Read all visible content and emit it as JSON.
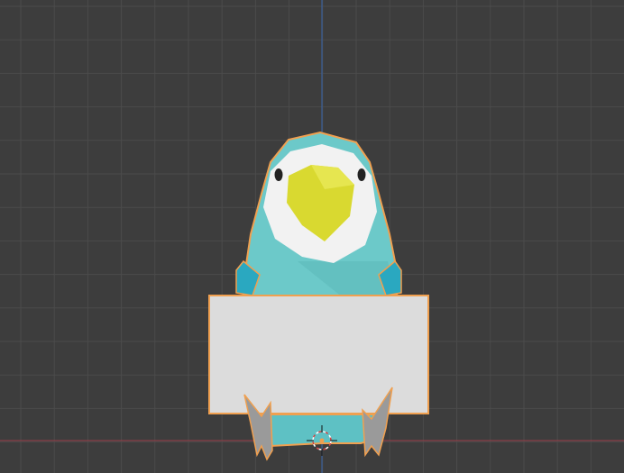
{
  "viewport": {
    "background": "#3d3d3d",
    "grid_color": "#4b4b4b",
    "x_axis_color": "#8a4048",
    "z_axis_color": "#3a5f9a"
  },
  "model": {
    "selected": true,
    "outline_color": "#f0a050",
    "body_color": "#6cc9c9",
    "face_color": "#f2f2f2",
    "beak_color": "#d9d930",
    "sign_color": "#dcdcdc",
    "feet_color": "#9a9a9a"
  },
  "cursor_3d": {
    "icon": "3d-cursor-icon"
  }
}
